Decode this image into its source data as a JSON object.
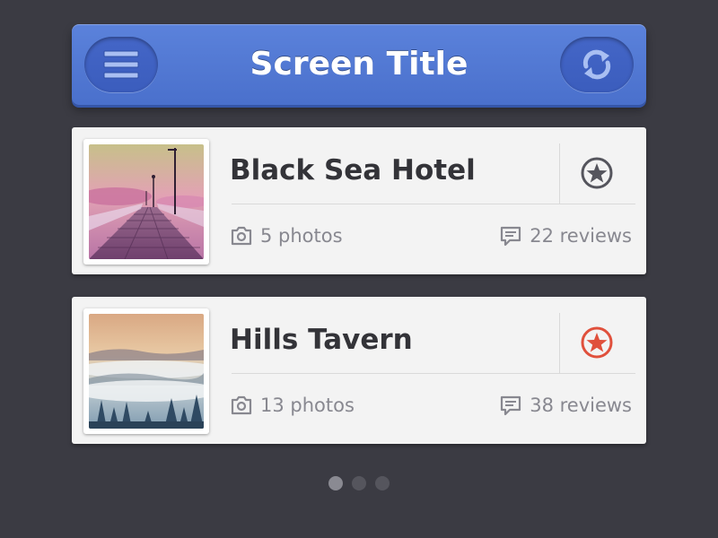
{
  "header": {
    "title": "Screen Title",
    "menu_icon": "hamburger-menu-icon",
    "refresh_icon": "refresh-icon"
  },
  "listings": [
    {
      "name": "Black Sea Hotel",
      "photos": "5 photos",
      "reviews": "22 reviews",
      "favorited": false,
      "thumbnail": "pier-at-sunset-photo"
    },
    {
      "name": "Hills Tavern",
      "photos": "13 photos",
      "reviews": "38 reviews",
      "favorited": true,
      "thumbnail": "misty-forest-hills-photo"
    }
  ],
  "pagination": {
    "pages": 3,
    "active": 1
  },
  "colors": {
    "background": "#3b3b43",
    "header_blue": "#5079d4",
    "card": "#f3f3f3",
    "title_text": "#333338",
    "meta_text": "#888890",
    "star_inactive": "#55555d",
    "star_active": "#e0503c"
  }
}
